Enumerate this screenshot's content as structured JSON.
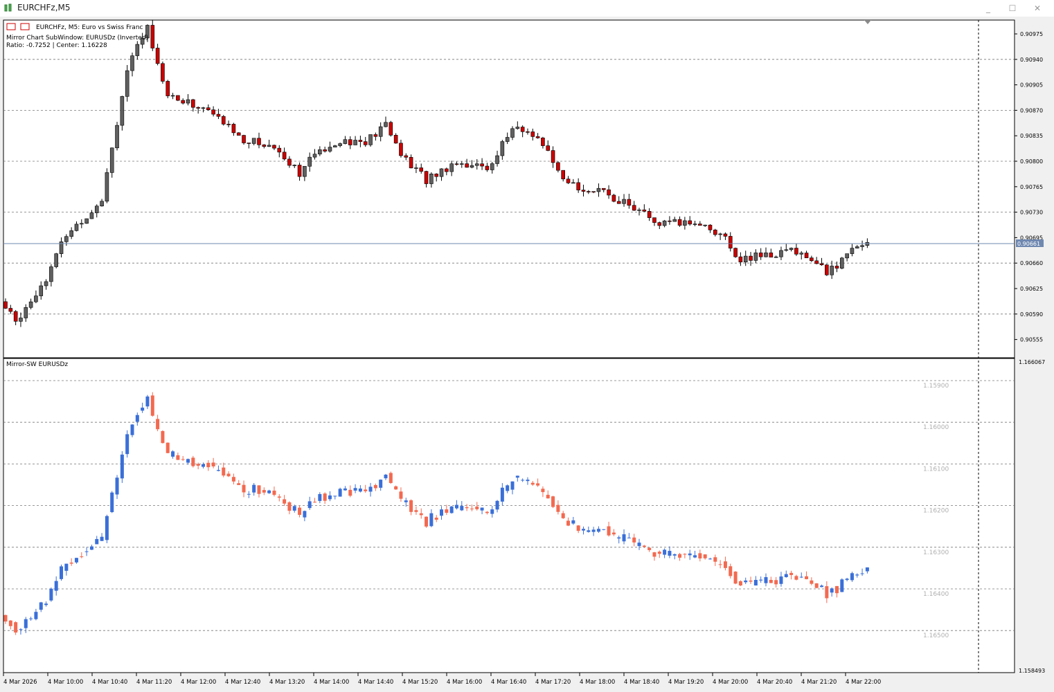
{
  "window": {
    "title": "EURCHFz,M5",
    "controls": {
      "minimize": "_",
      "maximize": "☐",
      "close": "✕"
    }
  },
  "main_panel": {
    "info_lines": [
      "EURCHFz, M5:  Euro vs Swiss Franc",
      "Mirror Chart SubWindow: EURUSDz (Inverted)",
      "Ratio: -0.7252  |  Center: 1.16228"
    ],
    "price_labels": [
      "0.90975",
      "0.90940",
      "0.90905",
      "0.90870",
      "0.90835",
      "0.90800",
      "0.90765",
      "0.90730",
      "0.90695",
      "0.90660",
      "0.90625",
      "0.90590",
      "0.90555"
    ],
    "current_price": "0.90661",
    "colors": {
      "bull": "#606060",
      "bear": "#cc0000",
      "wick": "#000000",
      "bid_line": "#5a7aa8",
      "grid": "#555555"
    }
  },
  "sub_panel": {
    "name": "Mirror-SW EURUSDz",
    "top_value": "1.166067",
    "bottom_value": "1.158493",
    "level_labels": [
      "1.15900",
      "1.16000",
      "1.16100",
      "1.16200",
      "1.16300",
      "1.16400",
      "1.16500"
    ],
    "colors": {
      "bull": "#3a6fd8",
      "bear": "#f26a50"
    }
  },
  "time_axis": {
    "labels": [
      "4 Mar 2026",
      "4 Mar 10:00",
      "4 Mar 10:40",
      "4 Mar 11:20",
      "4 Mar 12:00",
      "4 Mar 12:40",
      "4 Mar 13:20",
      "4 Mar 14:00",
      "4 Mar 14:40",
      "4 Mar 15:20",
      "4 Mar 16:00",
      "4 Mar 16:40",
      "4 Mar 17:20",
      "4 Mar 18:00",
      "4 Mar 18:40",
      "4 Mar 19:20",
      "4 Mar 20:00",
      "4 Mar 20:40",
      "4 Mar 21:20",
      "4 Mar 22:00"
    ]
  },
  "chart_data": [
    {
      "type": "candlestick",
      "symbol": "EURCHFz",
      "timeframe": "M5",
      "ylim": [
        0.90535,
        0.90995
      ],
      "candles_close_approx": [
        0.90607,
        0.90585,
        0.90575,
        0.9058,
        0.90605,
        0.90615,
        0.90625,
        0.90647,
        0.90615,
        0.90635,
        0.90638,
        0.90642,
        0.90652,
        0.907,
        0.90712,
        0.9072,
        0.90722,
        0.9074,
        0.9072,
        0.9068,
        0.9075,
        0.90785,
        0.90825,
        0.90845,
        0.9087,
        0.90925,
        0.90955,
        0.9096,
        0.90985,
        0.9095,
        0.90965,
        0.90948,
        0.9089,
        0.9088,
        0.9085,
        0.909,
        0.9089,
        0.90875,
        0.9088,
        0.90885,
        0.90875,
        0.9087,
        0.90878,
        0.90875,
        0.90883,
        0.90866
      ]
    },
    {
      "type": "candlestick",
      "symbol": "EURUSDz (Inverted mirror)",
      "ylim": [
        1.158493,
        1.166067
      ]
    }
  ]
}
